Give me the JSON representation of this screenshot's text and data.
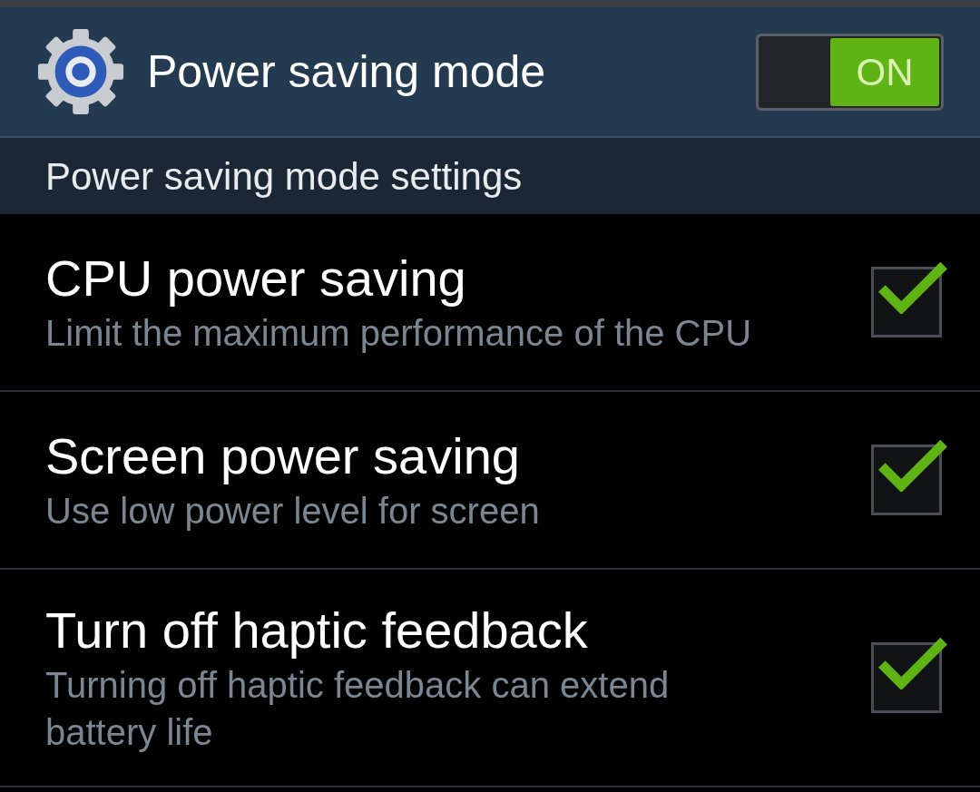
{
  "header": {
    "title": "Power saving mode",
    "switch": {
      "label": "ON",
      "on": true
    }
  },
  "section": {
    "title": "Power saving mode settings"
  },
  "options": [
    {
      "title": "CPU power saving",
      "summary": "Limit the maximum performance of the CPU",
      "checked": true
    },
    {
      "title": "Screen power saving",
      "summary": "Use low power level for screen",
      "checked": true
    },
    {
      "title": "Turn off haptic feedback",
      "summary": "Turning off haptic feedback can extend battery life",
      "checked": true
    }
  ]
}
